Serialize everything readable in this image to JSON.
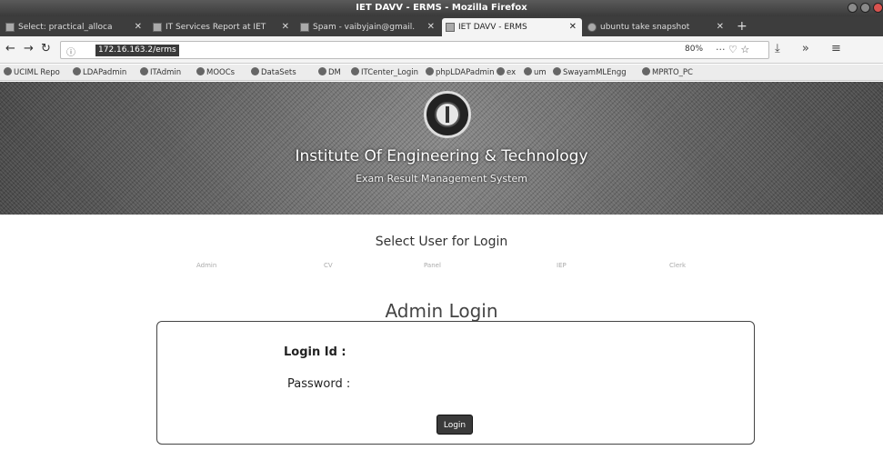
{
  "window": {
    "title": "IET DAVV - ERMS - Mozilla Firefox"
  },
  "tabs": [
    {
      "label": "Select: practical_alloca",
      "icon": "page-icon"
    },
    {
      "label": "IT Services Report at IET",
      "icon": "mail-icon"
    },
    {
      "label": "Spam - vaibyjain@gmail.",
      "icon": "mail-icon"
    },
    {
      "label": "IET DAVV - ERMS",
      "icon": "page-icon"
    },
    {
      "label": "ubuntu take snapshot",
      "icon": "globe-icon"
    }
  ],
  "nav": {
    "url": "172.16.163.2/erms",
    "zoom": "80%",
    "url_icons": "··· ♡ ☆",
    "right_icons": "⤓ » ≡"
  },
  "bookmarks": [
    "UCIML Repo",
    "LDAPadmin",
    "ITAdmin",
    "MOOCs",
    "DataSets",
    "DM",
    "ITCenter_Login",
    "phpLDAPadmin",
    "ex",
    "um",
    "SwayamMLEngg",
    "MPRTO_PC"
  ],
  "banner": {
    "title": "Institute Of Engineering & Technology",
    "subtitle": "Exam Result Management System"
  },
  "select_user": {
    "title": "Select User for Login",
    "roles": [
      "Admin",
      "CV",
      "Panel",
      "IEP",
      "Clerk"
    ]
  },
  "login": {
    "title": "Admin Login",
    "login_id_label": "Login Id :",
    "password_label": "Password :",
    "button": "Login"
  }
}
